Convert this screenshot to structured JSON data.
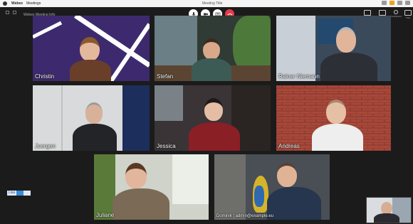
{
  "menubar": {
    "app_name": "Webex",
    "menu_item": "Meetings",
    "window_title": "Meeting Title"
  },
  "appbar": {
    "meeting_label": "Webex Meeting Info"
  },
  "controls": [
    "audio-icon",
    "video-icon",
    "share-icon",
    "more-icon",
    "end-call-icon"
  ],
  "right_controls": [
    "Layout",
    "View",
    "Participants",
    "Chat"
  ],
  "colors": {
    "end_call": "#e23c4b",
    "background": "#1b1b1b",
    "badge": "#3a8ad6"
  },
  "participants": [
    {
      "name": "Christin",
      "bg": "#3d2a6e"
    },
    {
      "name": "Stefan",
      "bg": "#2f3b34"
    },
    {
      "name": "Rainer Niemann",
      "bg": "#3a4a5a"
    },
    {
      "name": "Juergen",
      "bg": "#d9dadb"
    },
    {
      "name": "Jessica",
      "bg": "#3a3436"
    },
    {
      "name": "Andreas",
      "bg": "#a8483a"
    },
    {
      "name": "Juliane",
      "bg": "#cfd3c9"
    },
    {
      "name": "Dominik | admin@example.eu",
      "bg": "#4a4e55"
    }
  ],
  "badge": {
    "label": "Lisa"
  }
}
